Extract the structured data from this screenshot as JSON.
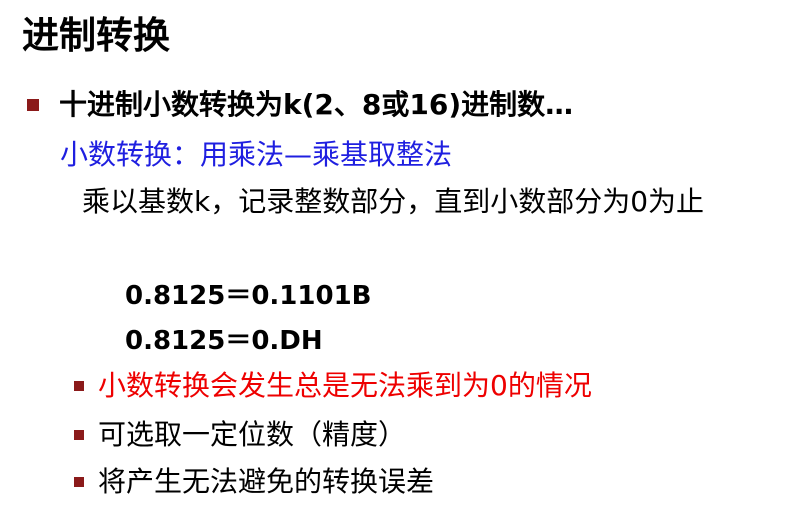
{
  "slide": {
    "title": "进制转换",
    "main_bullet": "十进制小数转换为k(2、8或16)进制数…",
    "method_line": "小数转换：用乘法—乘基取整法",
    "description": "乘以基数k，记录整数部分，直到小数部分为0为止",
    "formulas": [
      "0.8125＝0.1101B",
      "0.8125＝0.DH"
    ],
    "sub_bullets": [
      "小数转换会发生总是无法乘到为0的情况",
      "可选取一定位数（精度）",
      "将产生无法避免的转换误差"
    ],
    "colors": {
      "bullet": "#8b1a1a",
      "method_text": "#1f1fe0",
      "warning_text": "#ee0000"
    }
  }
}
